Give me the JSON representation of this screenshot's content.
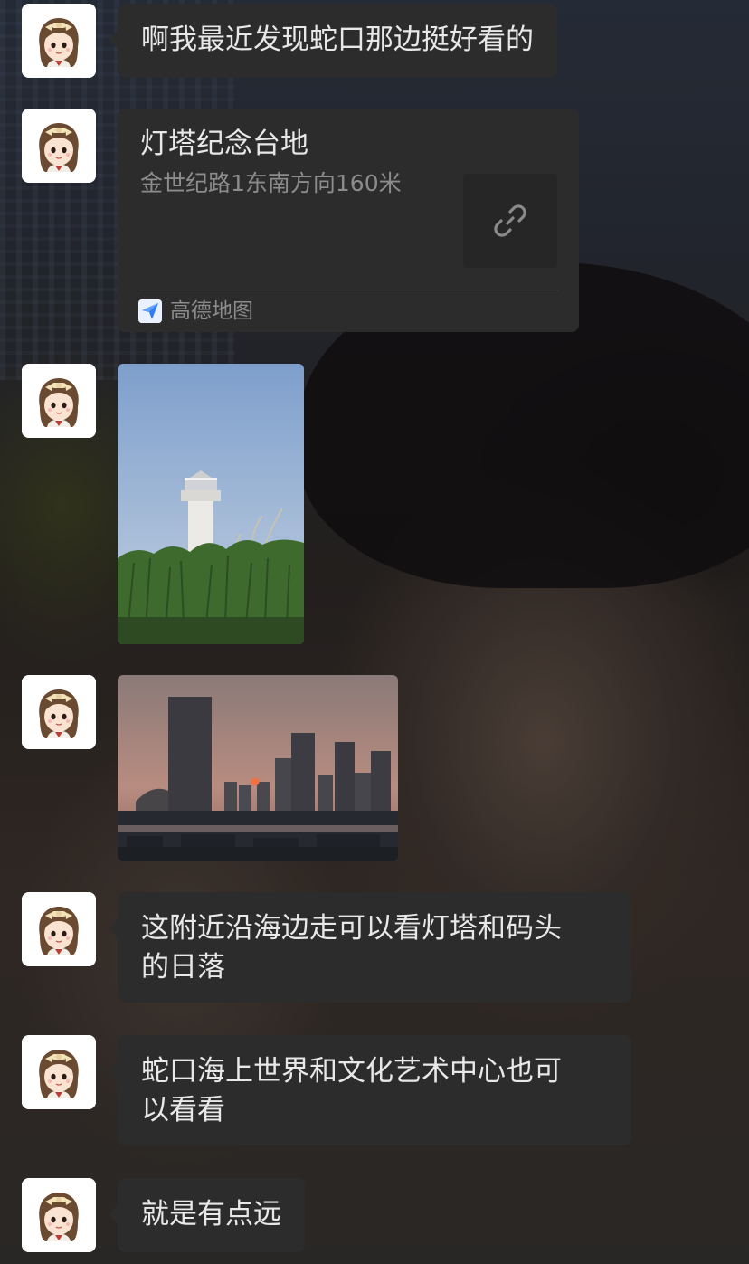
{
  "chat": {
    "messages": [
      {
        "type": "text",
        "text": "啊我最近发现蛇口那边挺好看的"
      },
      {
        "type": "location_card",
        "title": "灯塔纪念台地",
        "address": "金世纪路1东南方向160米",
        "source": "高德地图",
        "thumb_icon": "link-icon"
      },
      {
        "type": "image",
        "description_icon": "lighthouse-photo"
      },
      {
        "type": "image",
        "description_icon": "skyline-sunset-photo"
      },
      {
        "type": "text",
        "line1": "这附近沿海边走可以看灯塔和码头",
        "line2": "的日落"
      },
      {
        "type": "text",
        "line1": "蛇口海上世界和文化艺术中心也可",
        "line2": "以看看"
      },
      {
        "type": "text",
        "text": "就是有点远"
      }
    ]
  },
  "colors": {
    "bubble_bg": "#2c2c2c",
    "bubble_text": "#e8e8e8",
    "secondary_text": "#8c8c8c",
    "avatar_bg": "#ffffff"
  }
}
